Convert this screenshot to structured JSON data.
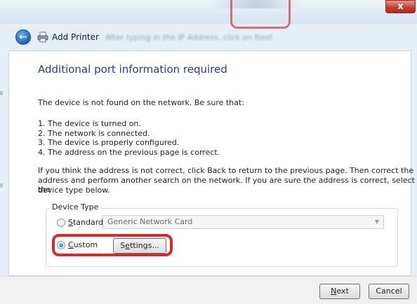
{
  "window": {
    "title": "Add Printer",
    "close_glyph": "x",
    "blurred_hint": "After typing in the IP Address, click on Next"
  },
  "header": {
    "back_glyph": "←"
  },
  "page": {
    "heading": "Additional port information required",
    "intro": "The device is not found on the network.  Be sure that:",
    "checklist": [
      "1.  The device is turned on.",
      "2.  The network is connected.",
      "3.  The device is properly configured.",
      "4.  The address on the previous page is correct."
    ],
    "advice_lines": [
      "If you think the address is not correct, click Back to return to the previous page.  Then correct the",
      "address and perform another search on the network.  If you are sure the address is correct, select the",
      "device type below."
    ]
  },
  "device_type": {
    "legend": "Device Type",
    "standard_first": "S",
    "standard_rest": "tandard",
    "standard_selected": false,
    "standard_value": "Generic Network Card",
    "custom_first": "C",
    "custom_rest": "ustom",
    "custom_selected": true,
    "settings_pre": "S",
    "settings_u": "e",
    "settings_post": "ttings..."
  },
  "footer": {
    "next_first": "N",
    "next_rest": "ext",
    "cancel": "Cancel"
  },
  "colors": {
    "heading": "#1f3d8c",
    "highlight": "#d32b2b",
    "close_button": "#c43a2c"
  },
  "icons": [
    "back-arrow-icon",
    "printer-icon",
    "close-icon",
    "chevron-down-icon"
  ]
}
